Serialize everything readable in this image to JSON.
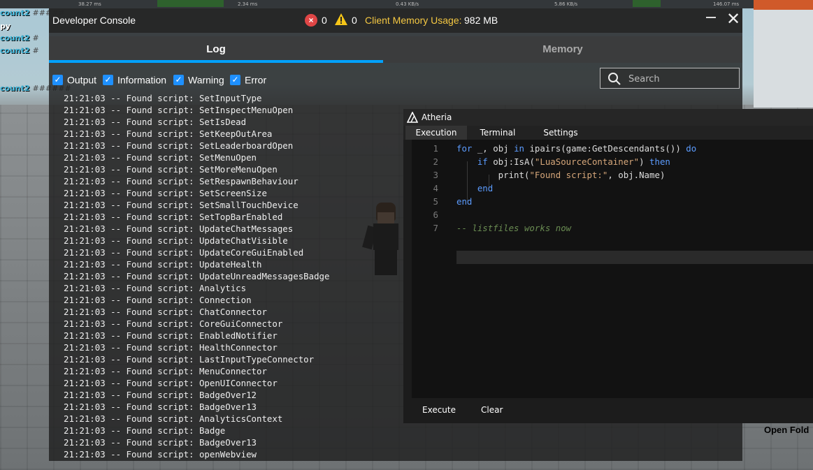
{
  "background": {
    "perf_stats": [
      "38.27 ms",
      "2.34 ms",
      "0.43 KB/s",
      "5.86 KB/s",
      "146.07 ms"
    ],
    "chat": [
      {
        "name": "count2",
        "hash": "#####"
      },
      {
        "name": "py",
        "hash": ""
      },
      {
        "name": "count2",
        "hash": "#"
      },
      {
        "name": "count2",
        "hash": "#"
      },
      {
        "name": "count2",
        "hash": "######"
      }
    ],
    "open_folder_label": "Open Fold"
  },
  "dev_console": {
    "title": "Developer Console",
    "error_count": "0",
    "warning_count": "0",
    "memory_label": "Client Memory Usage:",
    "memory_value": "982 MB",
    "tabs": {
      "log": "Log",
      "memory": "Memory"
    },
    "active_tab": "Log",
    "filters": {
      "output": {
        "label": "Output",
        "checked": true
      },
      "information": {
        "label": "Information",
        "checked": true
      },
      "warning": {
        "label": "Warning",
        "checked": true
      },
      "error": {
        "label": "Error",
        "checked": true
      }
    },
    "search_placeholder": "Search",
    "accent_color": "#00a2ff",
    "log_lines": [
      "21:21:03 -- Found script: SetInputType",
      "21:21:03 -- Found script: SetInspectMenuOpen",
      "21:21:03 -- Found script: SetIsDead",
      "21:21:03 -- Found script: SetKeepOutArea",
      "21:21:03 -- Found script: SetLeaderboardOpen",
      "21:21:03 -- Found script: SetMenuOpen",
      "21:21:03 -- Found script: SetMoreMenuOpen",
      "21:21:03 -- Found script: SetRespawnBehaviour",
      "21:21:03 -- Found script: SetScreenSize",
      "21:21:03 -- Found script: SetSmallTouchDevice",
      "21:21:03 -- Found script: SetTopBarEnabled",
      "21:21:03 -- Found script: UpdateChatMessages",
      "21:21:03 -- Found script: UpdateChatVisible",
      "21:21:03 -- Found script: UpdateCoreGuiEnabled",
      "21:21:03 -- Found script: UpdateHealth",
      "21:21:03 -- Found script: UpdateUnreadMessagesBadge",
      "21:21:03 -- Found script: Analytics",
      "21:21:03 -- Found script: Connection",
      "21:21:03 -- Found script: ChatConnector",
      "21:21:03 -- Found script: CoreGuiConnector",
      "21:21:03 -- Found script: EnabledNotifier",
      "21:21:03 -- Found script: HealthConnector",
      "21:21:03 -- Found script: LastInputTypeConnector",
      "21:21:03 -- Found script: MenuConnector",
      "21:21:03 -- Found script: OpenUIConnector",
      "21:21:03 -- Found script: BadgeOver12",
      "21:21:03 -- Found script: BadgeOver13",
      "21:21:03 -- Found script: AnalyticsContext",
      "21:21:03 -- Found script: Badge",
      "21:21:03 -- Found script: BadgeOver13",
      "21:21:03 -- Found script: openWebview"
    ]
  },
  "atheria": {
    "title": "Atheria",
    "tabs": [
      "Execution",
      "Terminal",
      "Settings"
    ],
    "active_tab": "Execution",
    "code_lines": [
      "for _, obj in ipairs(game:GetDescendants()) do",
      "    if obj:IsA(\"LuaSourceContainer\") then",
      "        print(\"Found script:\", obj.Name)",
      "    end",
      "end",
      "",
      "-- listfiles works now"
    ],
    "buttons": {
      "execute": "Execute",
      "clear": "Clear"
    }
  }
}
